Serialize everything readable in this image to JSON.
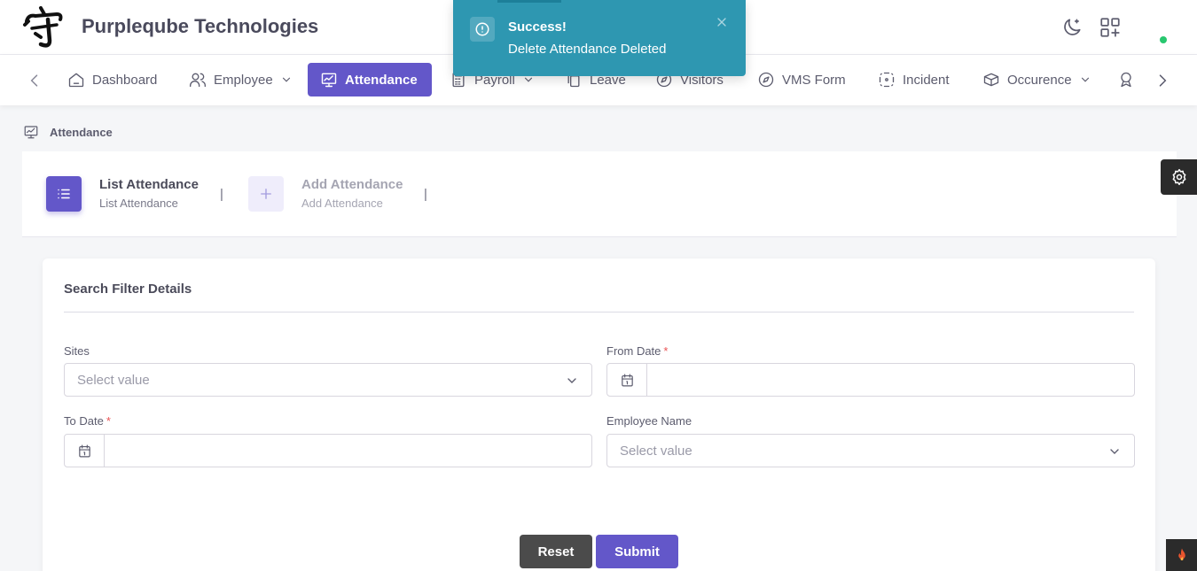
{
  "header": {
    "company": "Purpleqube Technologies"
  },
  "nav": {
    "items": [
      {
        "label": "Dashboard"
      },
      {
        "label": "Employee"
      },
      {
        "label": "Attendance"
      },
      {
        "label": "Payroll"
      },
      {
        "label": "Leave"
      },
      {
        "label": "Visitors"
      },
      {
        "label": "VMS Form"
      },
      {
        "label": "Incident"
      },
      {
        "label": "Occurence"
      }
    ]
  },
  "toast": {
    "title": "Success!",
    "message": "Delete Attendance Deleted"
  },
  "breadcrumb": {
    "current": "Attendance"
  },
  "tabs": [
    {
      "title": "List Attendance",
      "subtitle": "List Attendance"
    },
    {
      "title": "Add Attendance",
      "subtitle": "Add Attendance"
    }
  ],
  "tab_separator": "|",
  "filter": {
    "title": "Search Filter Details",
    "sites": {
      "label": "Sites",
      "placeholder": "Select value"
    },
    "from_date": {
      "label": "From Date",
      "required_mark": "*"
    },
    "to_date": {
      "label": "To Date",
      "required_mark": "*"
    },
    "employee_name": {
      "label": "Employee Name",
      "placeholder": "Select value"
    },
    "reset_label": "Reset",
    "submit_label": "Submit"
  },
  "colors": {
    "primary": "#6357c9",
    "toast_bg": "#2e97b1",
    "required": "#ea5455",
    "online": "#28c76f",
    "dark_button": "#4b4b4b"
  }
}
